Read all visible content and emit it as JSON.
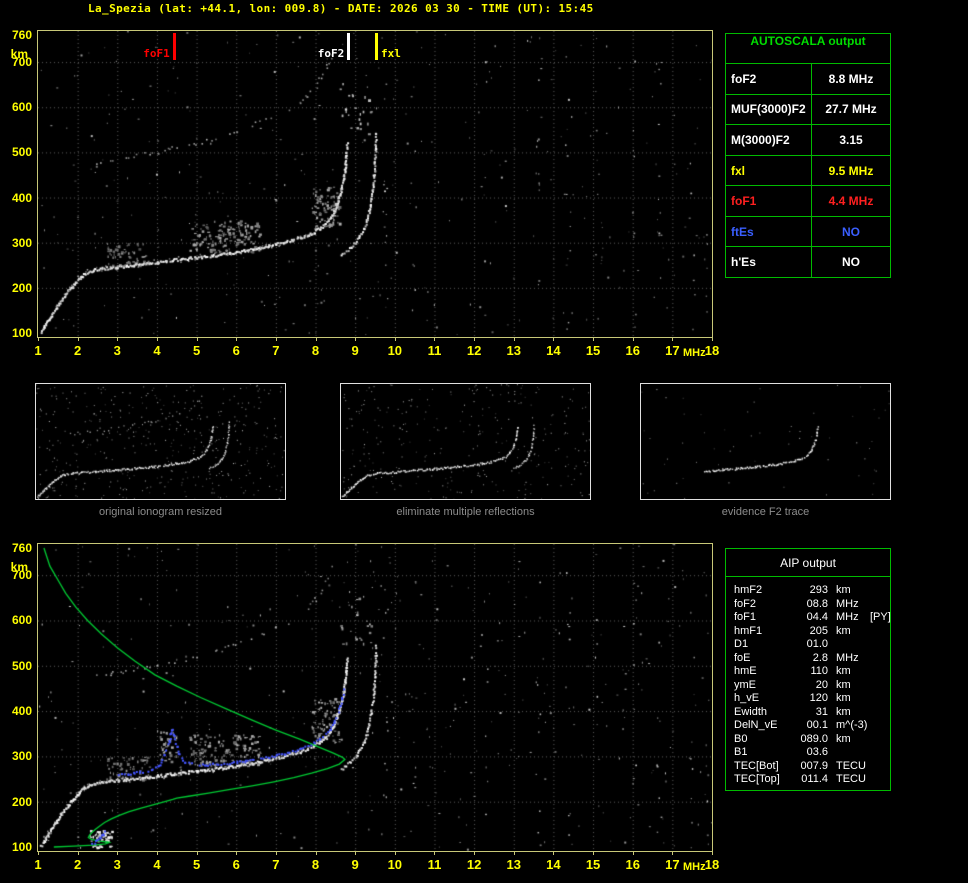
{
  "header": {
    "title": "La_Spezia (lat: +44.1, lon: 009.8) - DATE: 2026 03 30 - TIME (UT): 15:45"
  },
  "axes": {
    "x_ticks": [
      1,
      2,
      3,
      4,
      5,
      6,
      7,
      8,
      9,
      10,
      11,
      12,
      13,
      14,
      15,
      16,
      17,
      18
    ],
    "y_ticks": [
      760,
      700,
      600,
      500,
      400,
      300,
      200,
      100
    ],
    "x_unit": "MHz",
    "y_unit": "km"
  },
  "autoscala": {
    "title": "AUTOSCALA output",
    "rows": [
      {
        "label": "foF2",
        "value": "8.8 MHz",
        "color": "#ffffff"
      },
      {
        "label": "MUF(3000)F2",
        "value": "27.7 MHz",
        "color": "#ffffff"
      },
      {
        "label": "M(3000)F2",
        "value": "3.15",
        "color": "#ffffff"
      },
      {
        "label": "fxl",
        "value": "9.5 MHz",
        "color": "#ffff00"
      },
      {
        "label": "foF1",
        "value": "4.4 MHz",
        "color": "#ff2020"
      },
      {
        "label": "ftEs",
        "value": "NO",
        "color": "#3a5fff"
      },
      {
        "label": "h'Es",
        "value": "NO",
        "color": "#ffffff"
      }
    ]
  },
  "panels": [
    {
      "caption": "original ionogram resized",
      "mode": "original"
    },
    {
      "caption": "eliminate multiple reflections",
      "mode": "filtered"
    },
    {
      "caption": "evidence F2 trace",
      "mode": "f2"
    }
  ],
  "aip": {
    "title": "AIP output",
    "rows": [
      {
        "label": "hmF2",
        "value": "293",
        "unit": "km",
        "note": ""
      },
      {
        "label": "foF2",
        "value": "08.8",
        "unit": "MHz",
        "note": ""
      },
      {
        "label": "foF1",
        "value": "04.4",
        "unit": "MHz",
        "note": "[PY]"
      },
      {
        "label": "hmF1",
        "value": "205",
        "unit": "km",
        "note": ""
      },
      {
        "label": "D1",
        "value": "01.0",
        "unit": "",
        "note": ""
      },
      {
        "label": "foE",
        "value": "2.8",
        "unit": "MHz",
        "note": ""
      },
      {
        "label": "hmE",
        "value": "110",
        "unit": "km",
        "note": ""
      },
      {
        "label": "ymE",
        "value": "20",
        "unit": "km",
        "note": ""
      },
      {
        "label": "h_vE",
        "value": "120",
        "unit": "km",
        "note": ""
      },
      {
        "label": "Ewidth",
        "value": "31",
        "unit": "km",
        "note": ""
      },
      {
        "label": "DelN_vE",
        "value": "00.1",
        "unit": "m^(-3)",
        "note": ""
      },
      {
        "label": "B0",
        "value": "089.0",
        "unit": "km",
        "note": ""
      },
      {
        "label": "B1",
        "value": "03.6",
        "unit": "",
        "note": ""
      },
      {
        "label": "TEC[Bot]",
        "value": "007.9",
        "unit": "TECU",
        "note": ""
      },
      {
        "label": "TEC[Top]",
        "value": "011.4",
        "unit": "TECU",
        "note": ""
      }
    ]
  },
  "colors": {
    "axis_yellow": "#ffff00",
    "frame_yellow": "#c8c878",
    "table_green": "#00bb00",
    "profile_green": "#00cc33",
    "trace_blue": "#4455ff",
    "caption_gray": "#8c8c8c"
  },
  "chart_data": [
    {
      "type": "scatter",
      "title": "recorded ionogram with AUTOSCALA characteristic frequencies",
      "xlabel": "MHz",
      "ylabel": "km",
      "xlim": [
        1,
        18
      ],
      "ylim": [
        100,
        760
      ],
      "grid": true,
      "markers": [
        {
          "label": "foF1",
          "x": 4.4,
          "color": "#ff0000",
          "side": "left"
        },
        {
          "label": "foF2",
          "x": 8.8,
          "color": "#ffffff",
          "side": "left"
        },
        {
          "label": "fxl",
          "x": 9.5,
          "color": "#ffff00",
          "side": "right"
        }
      ],
      "series": [
        {
          "name": "o-trace",
          "points": [
            [
              1.05,
              103
            ],
            [
              1.15,
              116
            ],
            [
              1.25,
              130
            ],
            [
              1.35,
              144
            ],
            [
              1.45,
              157
            ],
            [
              1.55,
              170
            ],
            [
              1.65,
              182
            ],
            [
              1.75,
              194
            ],
            [
              1.85,
              205
            ],
            [
              1.95,
              215
            ],
            [
              2.05,
              224
            ],
            [
              2.15,
              231
            ],
            [
              2.25,
              237
            ],
            [
              2.4,
              241
            ],
            [
              2.6,
              244
            ],
            [
              2.8,
              246
            ],
            [
              3.0,
              248
            ],
            [
              3.2,
              250
            ],
            [
              3.4,
              252
            ],
            [
              3.6,
              254
            ],
            [
              3.8,
              256
            ],
            [
              4.0,
              258
            ],
            [
              4.2,
              260
            ],
            [
              4.4,
              263
            ],
            [
              4.6,
              265
            ],
            [
              4.8,
              267
            ],
            [
              5.0,
              269
            ],
            [
              5.2,
              271
            ],
            [
              5.4,
              273
            ],
            [
              5.6,
              276
            ],
            [
              5.8,
              278
            ],
            [
              6.0,
              281
            ],
            [
              6.2,
              284
            ],
            [
              6.4,
              287
            ],
            [
              6.6,
              290
            ],
            [
              6.8,
              294
            ],
            [
              7.0,
              298
            ],
            [
              7.2,
              302
            ],
            [
              7.4,
              307
            ],
            [
              7.6,
              312
            ],
            [
              7.8,
              318
            ],
            [
              7.95,
              325
            ],
            [
              8.1,
              333
            ],
            [
              8.25,
              343
            ],
            [
              8.35,
              355
            ],
            [
              8.45,
              370
            ],
            [
              8.52,
              386
            ],
            [
              8.58,
              403
            ],
            [
              8.64,
              422
            ],
            [
              8.69,
              443
            ],
            [
              8.73,
              466
            ],
            [
              8.76,
              492
            ],
            [
              8.78,
              520
            ]
          ]
        },
        {
          "name": "x-trace",
          "points": [
            [
              8.62,
              272
            ],
            [
              8.75,
              281
            ],
            [
              8.88,
              291
            ],
            [
              9.0,
              302
            ],
            [
              9.1,
              315
            ],
            [
              9.2,
              331
            ],
            [
              9.28,
              350
            ],
            [
              9.34,
              372
            ],
            [
              9.39,
              396
            ],
            [
              9.43,
              422
            ],
            [
              9.46,
              450
            ],
            [
              9.48,
              480
            ],
            [
              9.5,
              512
            ],
            [
              9.51,
              545
            ]
          ]
        },
        {
          "name": "second-hop-multiple",
          "points": [
            [
              2.5,
              478
            ],
            [
              2.8,
              483
            ],
            [
              3.1,
              488
            ],
            [
              3.4,
              492
            ],
            [
              3.7,
              497
            ],
            [
              4.0,
              502
            ],
            [
              4.3,
              508
            ],
            [
              4.6,
              514
            ],
            [
              4.9,
              520
            ],
            [
              5.2,
              527
            ],
            [
              5.5,
              534
            ],
            [
              5.8,
              542
            ],
            [
              6.1,
              551
            ],
            [
              6.4,
              561
            ],
            [
              6.7,
              572
            ],
            [
              7.0,
              584
            ],
            [
              7.3,
              597
            ],
            [
              7.6,
              612
            ],
            [
              7.8,
              628
            ],
            [
              8.0,
              648
            ],
            [
              8.15,
              670
            ],
            [
              8.3,
              695
            ],
            [
              8.4,
              720
            ]
          ]
        }
      ]
    },
    {
      "type": "line",
      "title": "AIP inversion: restored trace and plasma frequency profile",
      "xlabel": "MHz",
      "ylabel": "km",
      "xlim": [
        1,
        18
      ],
      "ylim": [
        100,
        760
      ],
      "grid": true,
      "series": [
        {
          "name": "plasma-frequency-profile",
          "color": "#00cc33",
          "points": [
            [
              1.15,
              760
            ],
            [
              1.3,
              720
            ],
            [
              1.5,
              690
            ],
            [
              1.7,
              660
            ],
            [
              1.95,
              630
            ],
            [
              2.25,
              600
            ],
            [
              2.6,
              570
            ],
            [
              3.0,
              540
            ],
            [
              3.45,
              510
            ],
            [
              3.95,
              480
            ],
            [
              4.5,
              455
            ],
            [
              5.1,
              430
            ],
            [
              5.75,
              405
            ],
            [
              6.4,
              380
            ],
            [
              7.0,
              358
            ],
            [
              7.6,
              338
            ],
            [
              8.1,
              320
            ],
            [
              8.45,
              307
            ],
            [
              8.68,
              298
            ],
            [
              8.74,
              293
            ],
            [
              8.6,
              283
            ],
            [
              8.3,
              273
            ],
            [
              7.9,
              263
            ],
            [
              7.45,
              253
            ],
            [
              6.95,
              244
            ],
            [
              6.4,
              235
            ],
            [
              5.85,
              227
            ],
            [
              5.3,
              219
            ],
            [
              4.8,
              212
            ],
            [
              4.5,
              208
            ],
            [
              4.4,
              205
            ],
            [
              4.2,
              200
            ],
            [
              3.9,
              193
            ],
            [
              3.6,
              186
            ],
            [
              3.3,
              178
            ],
            [
              3.05,
              170
            ],
            [
              2.85,
              162
            ],
            [
              2.68,
              154
            ],
            [
              2.55,
              146
            ],
            [
              2.45,
              139
            ],
            [
              2.36,
              132
            ],
            [
              2.3,
              126
            ],
            [
              2.27,
              121
            ],
            [
              2.35,
              117
            ],
            [
              2.55,
              113
            ],
            [
              2.75,
              111
            ],
            [
              2.8,
              110
            ],
            [
              2.7,
              107
            ],
            [
              2.4,
              104
            ],
            [
              1.9,
              102
            ],
            [
              1.4,
              100
            ]
          ]
        },
        {
          "name": "restored-F-trace",
          "color": "#4455ff",
          "points": [
            [
              2.95,
              258
            ],
            [
              3.1,
              261
            ],
            [
              3.25,
              263
            ],
            [
              3.4,
              265
            ],
            [
              3.55,
              267
            ],
            [
              3.7,
              269
            ],
            [
              3.85,
              272
            ],
            [
              3.95,
              276
            ],
            [
              4.05,
              283
            ],
            [
              4.12,
              293
            ],
            [
              4.18,
              306
            ],
            [
              4.24,
              320
            ],
            [
              4.29,
              335
            ],
            [
              4.33,
              350
            ],
            [
              4.36,
              360
            ],
            [
              4.4,
              352
            ],
            [
              4.44,
              338
            ],
            [
              4.48,
              322
            ],
            [
              4.53,
              308
            ],
            [
              4.6,
              297
            ],
            [
              4.7,
              290
            ],
            [
              4.85,
              286
            ],
            [
              5.0,
              284
            ],
            [
              5.2,
              283
            ],
            [
              5.4,
              284
            ],
            [
              5.6,
              285
            ],
            [
              5.8,
              287
            ],
            [
              6.0,
              289
            ],
            [
              6.2,
              291
            ],
            [
              6.4,
              294
            ],
            [
              6.6,
              297
            ],
            [
              6.8,
              300
            ],
            [
              7.0,
              304
            ],
            [
              7.2,
              308
            ],
            [
              7.4,
              313
            ],
            [
              7.6,
              318
            ],
            [
              7.8,
              325
            ],
            [
              7.95,
              332
            ],
            [
              8.1,
              340
            ],
            [
              8.25,
              350
            ],
            [
              8.35,
              362
            ],
            [
              8.45,
              377
            ],
            [
              8.53,
              394
            ],
            [
              8.6,
              413
            ],
            [
              8.66,
              433
            ],
            [
              8.7,
              452
            ]
          ]
        },
        {
          "name": "restored-E-trace",
          "color": "#4455ff",
          "points": [
            [
              2.35,
              108
            ],
            [
              2.45,
              115
            ],
            [
              2.55,
              122
            ],
            [
              2.62,
              130
            ],
            [
              2.68,
              138
            ]
          ]
        }
      ]
    }
  ]
}
